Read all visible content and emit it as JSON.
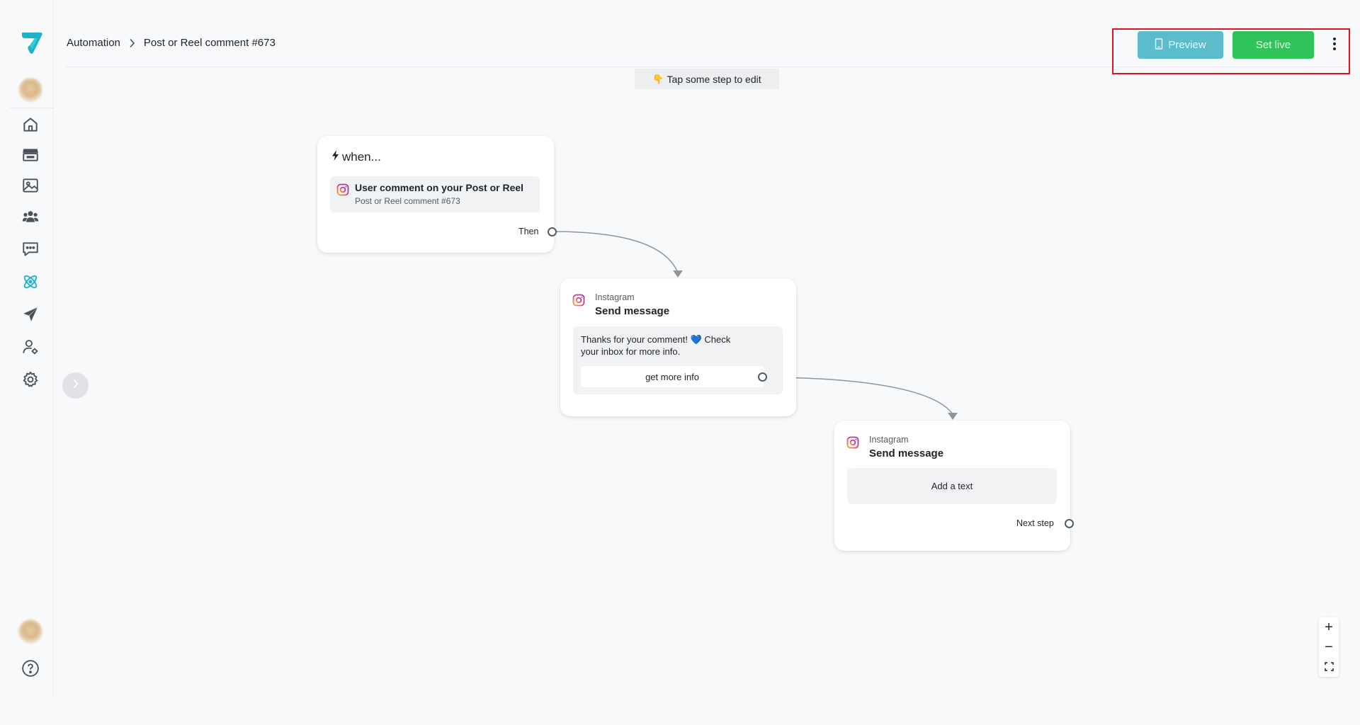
{
  "header": {
    "breadcrumb_root": "Automation",
    "breadcrumb_current": "Post or Reel comment #673",
    "preview_label": "Preview",
    "set_live_label": "Set live"
  },
  "hint": {
    "emoji": "👇",
    "text": "Tap some step to edit"
  },
  "sidebar": {
    "items": [
      "home-icon",
      "store-icon",
      "image-icon",
      "users-icon",
      "chat-icon",
      "atom-icon",
      "send-icon",
      "user-settings-icon",
      "gear-icon"
    ],
    "help": "help-icon"
  },
  "trigger": {
    "title": "when...",
    "event_title": "User comment on your Post or Reel",
    "event_sub": "Post or Reel comment #673",
    "port_label": "Then"
  },
  "step1": {
    "platform": "Instagram",
    "title": "Send message",
    "message": "Thanks for your comment! 💙 Check your inbox for more info.",
    "button_label": "get more info"
  },
  "step2": {
    "platform": "Instagram",
    "title": "Send message",
    "add_text": "Add a text",
    "port_label": "Next step"
  },
  "zoom": {
    "zoom_in": "+",
    "zoom_out": "−"
  },
  "colors": {
    "preview": "#5bbccc",
    "set_live": "#2fc35a",
    "highlight": "#e0141e",
    "brand": "#1fb3c9"
  }
}
